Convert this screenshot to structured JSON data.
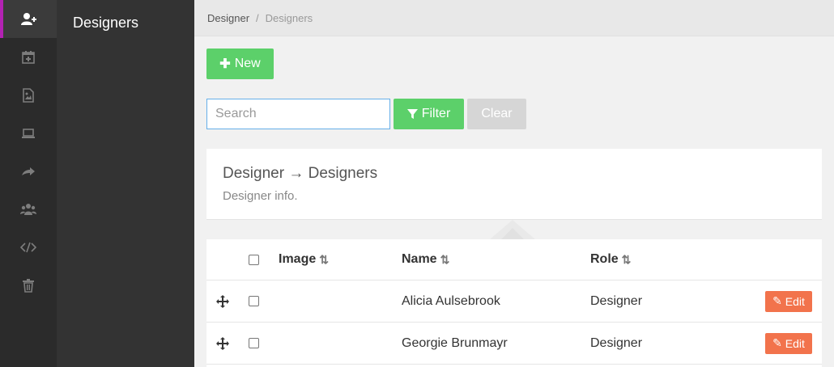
{
  "sidebar": {
    "icons": [
      "add-user-icon",
      "calendar-plus-icon",
      "image-file-icon",
      "laptop-icon",
      "share-arrow-icon",
      "group-icon",
      "code-icon",
      "trash-icon"
    ],
    "active_index": 0
  },
  "subnav": {
    "title": "Designers"
  },
  "breadcrumb": {
    "parent": "Designer",
    "separator": "/",
    "current": "Designers"
  },
  "toolbar": {
    "new_label": "New",
    "search_placeholder": "Search",
    "search_value": "",
    "filter_label": "Filter",
    "clear_label": "Clear"
  },
  "info": {
    "title": "Designer → Designers",
    "subtitle": "Designer info."
  },
  "table": {
    "headers": {
      "image": "Image",
      "name": "Name",
      "role": "Role"
    },
    "rows": [
      {
        "name": "Alicia Aulsebrook",
        "role": "Designer",
        "edit_label": "Edit"
      },
      {
        "name": "Georgie Brunmayr",
        "role": "Designer",
        "edit_label": "Edit"
      }
    ]
  },
  "colors": {
    "accent_green": "#5cd06a",
    "edit_orange": "#f2734c",
    "active_marker": "#b322b3",
    "sidebar_dark": "#2b2b2b"
  }
}
